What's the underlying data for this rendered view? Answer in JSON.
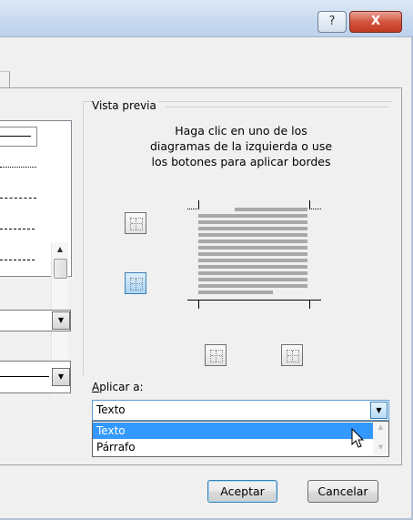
{
  "titlebar": {
    "help_label": "?",
    "close_label": "X"
  },
  "preview": {
    "title": "Vista previa",
    "instructions": "Haga clic en uno de los diagramas de la izquierda o use los botones para aplicar bordes"
  },
  "apply": {
    "label_prefix": "",
    "label_accel": "A",
    "label_rest": "plicar a:",
    "selected": "Texto",
    "options": [
      "Texto",
      "Párrafo"
    ]
  },
  "buttons": {
    "ok": "Aceptar",
    "cancel": "Cancelar"
  },
  "colors": {
    "selection": "#3399ff",
    "close_red": "#c23a22",
    "accent_blue": "#3c7fb1"
  }
}
